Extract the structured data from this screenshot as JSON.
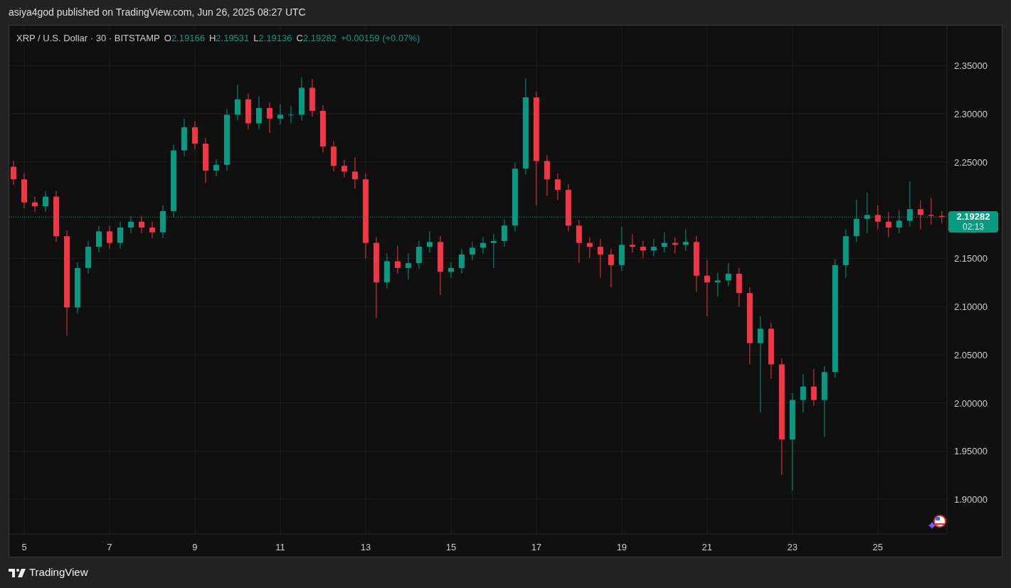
{
  "header": {
    "text": "asiya4god published on TradingView.com, Jun 26, 2025 08:27 UTC"
  },
  "legend": {
    "symbol": "XRP / U.S. Dollar · 30 · BITSTAMP",
    "values": [
      {
        "label": "O",
        "value": "2.19166"
      },
      {
        "label": "H",
        "value": "2.19531"
      },
      {
        "label": "L",
        "value": "2.19136"
      },
      {
        "label": "C",
        "value": "2.19282"
      }
    ],
    "change": "+0.00159 (+0.07%)"
  },
  "price_label": {
    "price": "2.19282",
    "countdown": "02:13"
  },
  "chart_data": {
    "type": "candlestick",
    "grid": true,
    "ref_lines": [
      {
        "axis": "y",
        "value": 2.19282
      }
    ],
    "xlim": [
      4.65,
      26.62
    ],
    "ylim": [
      1.864,
      2.3915
    ],
    "xticks": [
      5,
      7,
      9,
      11,
      13,
      15,
      17,
      19,
      21,
      23,
      25
    ],
    "yticks": [
      {
        "value": 1.9,
        "label": "1.90000"
      },
      {
        "value": 1.95,
        "label": "1.95000"
      },
      {
        "value": 2.0,
        "label": "2.00000"
      },
      {
        "value": 2.05,
        "label": "2.05000"
      },
      {
        "value": 2.1,
        "label": "2.10000"
      },
      {
        "value": 2.15,
        "label": "2.15000"
      },
      {
        "value": 2.25,
        "label": "2.25000"
      },
      {
        "value": 2.3,
        "label": "2.30000"
      },
      {
        "value": 2.35,
        "label": "2.35000"
      }
    ],
    "x": [
      4.75,
      5,
      5.25,
      5.5,
      5.75,
      6,
      6.25,
      6.5,
      6.75,
      7,
      7.25,
      7.5,
      7.75,
      8,
      8.25,
      8.5,
      8.75,
      9,
      9.25,
      9.5,
      9.75,
      10,
      10.25,
      10.5,
      10.75,
      11,
      11.25,
      11.5,
      11.75,
      12,
      12.25,
      12.5,
      12.75,
      13,
      13.25,
      13.5,
      13.75,
      14,
      14.25,
      14.5,
      14.75,
      15,
      15.25,
      15.5,
      15.75,
      16,
      16.25,
      16.5,
      16.75,
      17,
      17.25,
      17.5,
      17.75,
      18,
      18.25,
      18.5,
      18.75,
      19,
      19.25,
      19.5,
      19.75,
      20,
      20.25,
      20.5,
      20.75,
      21,
      21.25,
      21.5,
      21.75,
      22,
      22.25,
      22.5,
      22.75,
      23,
      23.25,
      23.5,
      23.75,
      24,
      24.25,
      24.5,
      24.75,
      25,
      25.25,
      25.5,
      25.75,
      26,
      26.25,
      26.5
    ],
    "ohlc": [
      [
        2.245,
        2.251,
        2.226,
        2.232
      ],
      [
        2.232,
        2.238,
        2.202,
        2.208
      ],
      [
        2.208,
        2.214,
        2.198,
        2.204
      ],
      [
        2.204,
        2.22,
        2.198,
        2.214
      ],
      [
        2.214,
        2.22,
        2.167,
        2.173
      ],
      [
        2.173,
        2.179,
        2.07,
        2.099
      ],
      [
        2.099,
        2.146,
        2.093,
        2.14
      ],
      [
        2.14,
        2.168,
        2.134,
        2.162
      ],
      [
        2.162,
        2.184,
        2.156,
        2.178
      ],
      [
        2.178,
        2.184,
        2.16,
        2.166
      ],
      [
        2.166,
        2.188,
        2.16,
        2.182
      ],
      [
        2.182,
        2.194,
        2.176,
        2.188
      ],
      [
        2.188,
        2.194,
        2.176,
        2.182
      ],
      [
        2.182,
        2.188,
        2.171,
        2.177
      ],
      [
        2.177,
        2.205,
        2.171,
        2.199
      ],
      [
        2.199,
        2.268,
        2.193,
        2.262
      ],
      [
        2.262,
        2.295,
        2.256,
        2.286
      ],
      [
        2.286,
        2.292,
        2.263,
        2.269
      ],
      [
        2.269,
        2.275,
        2.228,
        2.241
      ],
      [
        2.241,
        2.253,
        2.235,
        2.247
      ],
      [
        2.247,
        2.305,
        2.241,
        2.299
      ],
      [
        2.299,
        2.33,
        2.293,
        2.315
      ],
      [
        2.315,
        2.321,
        2.284,
        2.29
      ],
      [
        2.29,
        2.318,
        2.284,
        2.306
      ],
      [
        2.306,
        2.312,
        2.28,
        2.295
      ],
      [
        2.295,
        2.31,
        2.289,
        2.299
      ],
      [
        2.299,
        2.308,
        2.29,
        2.299
      ],
      [
        2.299,
        2.338,
        2.293,
        2.327
      ],
      [
        2.327,
        2.336,
        2.297,
        2.303
      ],
      [
        2.303,
        2.309,
        2.26,
        2.266
      ],
      [
        2.266,
        2.272,
        2.24,
        2.246
      ],
      [
        2.246,
        2.252,
        2.234,
        2.24
      ],
      [
        2.24,
        2.255,
        2.222,
        2.232
      ],
      [
        2.232,
        2.238,
        2.15,
        2.166
      ],
      [
        2.166,
        2.172,
        2.088,
        2.125
      ],
      [
        2.125,
        2.155,
        2.119,
        2.147
      ],
      [
        2.147,
        2.163,
        2.134,
        2.14
      ],
      [
        2.14,
        2.155,
        2.128,
        2.145
      ],
      [
        2.145,
        2.168,
        2.139,
        2.162
      ],
      [
        2.162,
        2.178,
        2.156,
        2.167
      ],
      [
        2.167,
        2.173,
        2.112,
        2.136
      ],
      [
        2.136,
        2.146,
        2.13,
        2.14
      ],
      [
        2.14,
        2.16,
        2.134,
        2.154
      ],
      [
        2.154,
        2.167,
        2.148,
        2.161
      ],
      [
        2.161,
        2.172,
        2.155,
        2.166
      ],
      [
        2.166,
        2.175,
        2.14,
        2.168
      ],
      [
        2.168,
        2.19,
        2.162,
        2.184
      ],
      [
        2.184,
        2.249,
        2.178,
        2.243
      ],
      [
        2.243,
        2.337,
        2.237,
        2.317
      ],
      [
        2.317,
        2.323,
        2.205,
        2.251
      ],
      [
        2.251,
        2.257,
        2.215,
        2.232
      ],
      [
        2.232,
        2.238,
        2.21,
        2.221
      ],
      [
        2.221,
        2.227,
        2.178,
        2.184
      ],
      [
        2.184,
        2.19,
        2.145,
        2.166
      ],
      [
        2.166,
        2.172,
        2.15,
        2.162
      ],
      [
        2.162,
        2.17,
        2.13,
        2.154
      ],
      [
        2.154,
        2.16,
        2.12,
        2.143
      ],
      [
        2.143,
        2.183,
        2.137,
        2.164
      ],
      [
        2.164,
        2.175,
        2.156,
        2.162
      ],
      [
        2.162,
        2.168,
        2.15,
        2.158
      ],
      [
        2.158,
        2.17,
        2.152,
        2.162
      ],
      [
        2.162,
        2.177,
        2.156,
        2.166
      ],
      [
        2.166,
        2.172,
        2.155,
        2.164
      ],
      [
        2.164,
        2.18,
        2.158,
        2.167
      ],
      [
        2.167,
        2.173,
        2.115,
        2.132
      ],
      [
        2.132,
        2.148,
        2.09,
        2.125
      ],
      [
        2.125,
        2.135,
        2.11,
        2.127
      ],
      [
        2.127,
        2.145,
        2.121,
        2.134
      ],
      [
        2.134,
        2.14,
        2.1,
        2.114
      ],
      [
        2.114,
        2.12,
        2.04,
        2.062
      ],
      [
        2.062,
        2.09,
        1.99,
        2.077
      ],
      [
        2.077,
        2.083,
        2.025,
        2.04
      ],
      [
        2.04,
        2.046,
        1.925,
        1.962
      ],
      [
        1.962,
        2.01,
        1.909,
        2.003
      ],
      [
        2.003,
        2.03,
        1.99,
        2.017
      ],
      [
        2.017,
        2.035,
        1.997,
        2.003
      ],
      [
        2.003,
        2.038,
        1.965,
        2.032
      ],
      [
        2.032,
        2.149,
        2.026,
        2.143
      ],
      [
        2.143,
        2.18,
        2.13,
        2.173
      ],
      [
        2.173,
        2.211,
        2.167,
        2.191
      ],
      [
        2.191,
        2.218,
        2.176,
        2.195
      ],
      [
        2.195,
        2.205,
        2.18,
        2.188
      ],
      [
        2.188,
        2.198,
        2.172,
        2.182
      ],
      [
        2.182,
        2.2,
        2.176,
        2.189
      ],
      [
        2.189,
        2.23,
        2.183,
        2.201
      ],
      [
        2.201,
        2.21,
        2.18,
        2.195
      ],
      [
        2.195,
        2.213,
        2.185,
        2.194
      ],
      [
        2.194,
        2.199,
        2.186,
        2.193
      ]
    ]
  },
  "footer": {
    "brand": "TradingView"
  }
}
